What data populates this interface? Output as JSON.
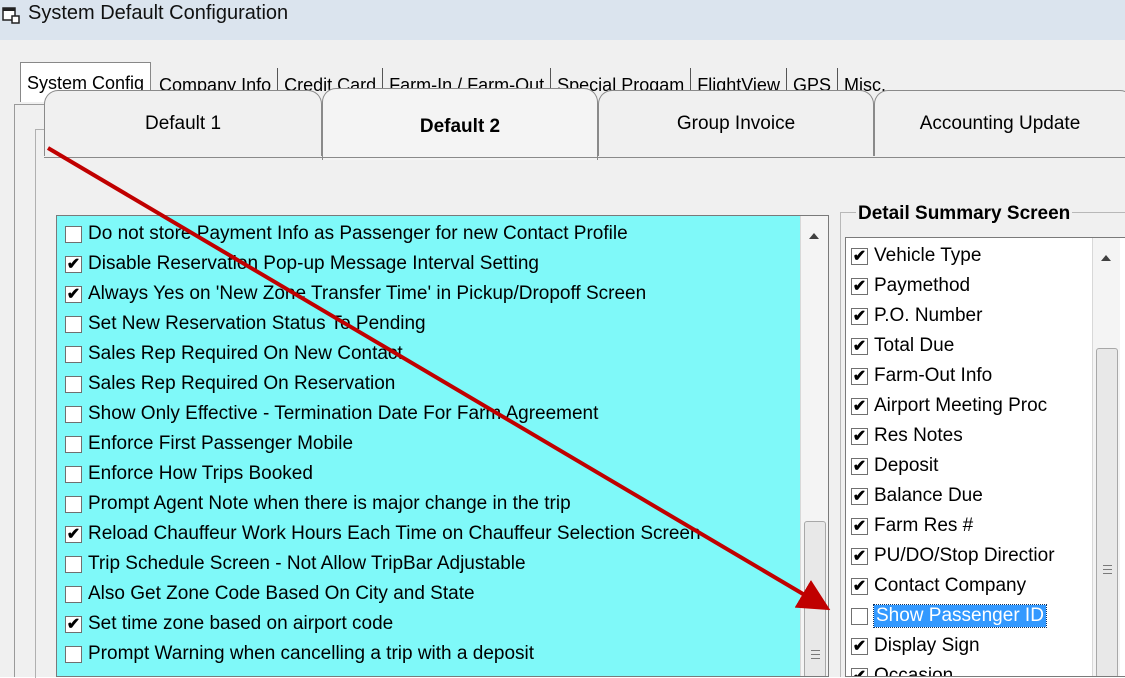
{
  "window": {
    "title": "System Default Configuration"
  },
  "main_tabs": [
    {
      "label": "System Config",
      "active": true
    },
    {
      "label": "Company Info"
    },
    {
      "label": "Credit Card"
    },
    {
      "label": "Farm-In / Farm-Out"
    },
    {
      "label": "Special Progam"
    },
    {
      "label": "FlightView"
    },
    {
      "label": "GPS"
    },
    {
      "label": "Misc."
    }
  ],
  "sub_tabs": [
    {
      "label": "Default 1"
    },
    {
      "label": "Default 2",
      "active": true
    },
    {
      "label": "Group Invoice"
    },
    {
      "label": "Accounting Update"
    }
  ],
  "options": [
    {
      "label": "Do not store Payment Info as Passenger for new Contact Profile",
      "checked": false
    },
    {
      "label": "Disable Reservation Pop-up Message Interval Setting",
      "checked": true
    },
    {
      "label": "Always Yes on 'New Zone Transfer Time' in Pickup/Dropoff Screen",
      "checked": true
    },
    {
      "label": "Set New Reservation Status To Pending",
      "checked": false
    },
    {
      "label": "Sales Rep Required On New Contact",
      "checked": false
    },
    {
      "label": "Sales Rep Required On Reservation",
      "checked": false
    },
    {
      "label": "Show Only Effective - Termination Date For Farm Agreement",
      "checked": false
    },
    {
      "label": "Enforce First Passenger Mobile",
      "checked": false
    },
    {
      "label": "Enforce How Trips Booked",
      "checked": false
    },
    {
      "label": "Prompt Agent Note when there is major change in the trip",
      "checked": false
    },
    {
      "label": "Reload Chauffeur Work Hours Each Time on Chauffeur Selection Screen",
      "checked": true
    },
    {
      "label": "Trip Schedule Screen - Not Allow TripBar Adjustable",
      "checked": false
    },
    {
      "label": "Also Get Zone Code Based On City and State",
      "checked": false
    },
    {
      "label": "Set time zone based on airport code",
      "checked": true
    },
    {
      "label": "Prompt Warning when cancelling a trip with a deposit",
      "checked": false
    }
  ],
  "detail_summary": {
    "title": "Detail Summary Screen",
    "items": [
      {
        "label": "Vehicle Type",
        "checked": true
      },
      {
        "label": "Paymethod",
        "checked": true
      },
      {
        "label": "P.O. Number",
        "checked": true
      },
      {
        "label": "Total Due",
        "checked": true
      },
      {
        "label": "Farm-Out Info",
        "checked": true
      },
      {
        "label": "Airport Meeting Proc",
        "checked": true
      },
      {
        "label": "Res Notes",
        "checked": true
      },
      {
        "label": "Deposit",
        "checked": true
      },
      {
        "label": "Balance Due",
        "checked": true
      },
      {
        "label": "Farm Res #",
        "checked": true
      },
      {
        "label": "PU/DO/Stop Directior",
        "checked": true
      },
      {
        "label": "Contact Company",
        "checked": true
      },
      {
        "label": "Show Passenger ID",
        "checked": false,
        "selected": true
      },
      {
        "label": "Display Sign",
        "checked": true
      },
      {
        "label": "Occasion",
        "checked": true
      }
    ]
  },
  "annotation": {
    "arrow_color": "#c00000"
  },
  "icons": {
    "check_mark": "✔",
    "window_icon": "app-window-icon"
  }
}
